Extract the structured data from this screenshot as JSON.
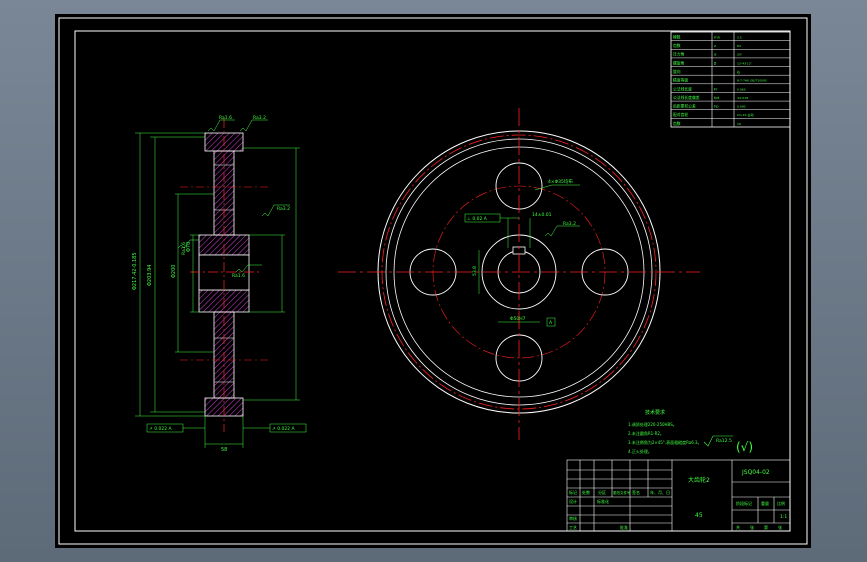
{
  "drawing": {
    "background_color": "#000000",
    "viewport_color": "#6b7785",
    "line_colors": {
      "outline": "#ffffff",
      "centerline": "#ff2020",
      "dimension": "#40ff40",
      "hatch": "#ff40ff"
    }
  },
  "params_table": {
    "rows": [
      [
        "模数",
        "mn",
        "2.5"
      ],
      [
        "齿数",
        "z",
        "84"
      ],
      [
        "压力角",
        "α",
        "20°"
      ],
      [
        "螺旋角",
        "β",
        "13°43′13″"
      ],
      [
        "旋向",
        "",
        "右"
      ],
      [
        "精度等级",
        "",
        "8-7-7HK GB/T10095"
      ],
      [
        "公法线长度",
        "Fr",
        "0.063"
      ],
      [
        "公法线长度偏差",
        "fpt",
        "±0.018"
      ],
      [
        "齿距累积公差",
        "Fp",
        "0.090"
      ],
      [
        "配对齿轮",
        "",
        "zm-15-主动"
      ],
      [
        "齿数",
        "",
        "19"
      ]
    ]
  },
  "side_view": {
    "roughness_top": "Ra1.6",
    "roughness_top2": "Ra3.2",
    "roughness_mid": "Ra3.2",
    "roughness_left": "Ra1.6",
    "roughness_bore": "Ra1.6",
    "dim_tip": "Φ217.42-0.185",
    "dim_root": "Φ203.94",
    "dim_hub": "Φ70",
    "dim_web": "Φ200",
    "dim_face": "58",
    "tol_left": "↗ 0.022 A",
    "tol_right": "↗ 0.022 A"
  },
  "front_view": {
    "hole_label": "4×Φ35均布",
    "flatness": "⊥ 0.02 A",
    "keyway_dim": "14±0.01",
    "key_height": "53.8",
    "bore_rough": "Ra3.2",
    "datum": "A",
    "bore_dim": "Φ50H7"
  },
  "tech_requirements": {
    "title": "技术要求",
    "items": [
      "1.调质处理220-250HBS。",
      "2.未注圆角R1-R2。",
      "3.未注倒角为2×45°,表面粗糙度Ra6.3。",
      "4.正火处理。"
    ]
  },
  "surface_finish": {
    "symbol": "Ra12.5",
    "paren": "(√)"
  },
  "title_block": {
    "part_name": "大齿轮2",
    "drawing_no": "JSQ04-02",
    "material": "45",
    "scale": "1:1",
    "stage_label": "阶段标记",
    "weight_label": "重量",
    "scale_label": "比例",
    "design": "设计",
    "standard": "标准化",
    "review": "审核",
    "process": "工艺",
    "approve": "批准",
    "marking": "标记",
    "count": "处数",
    "zone": "分区",
    "change_doc": "更改文件号",
    "sign": "签名",
    "date": "年、月、日",
    "sheet_total": "共",
    "sheet_of": "张",
    "sheet_no": "第",
    "sheet_unit": "张"
  }
}
